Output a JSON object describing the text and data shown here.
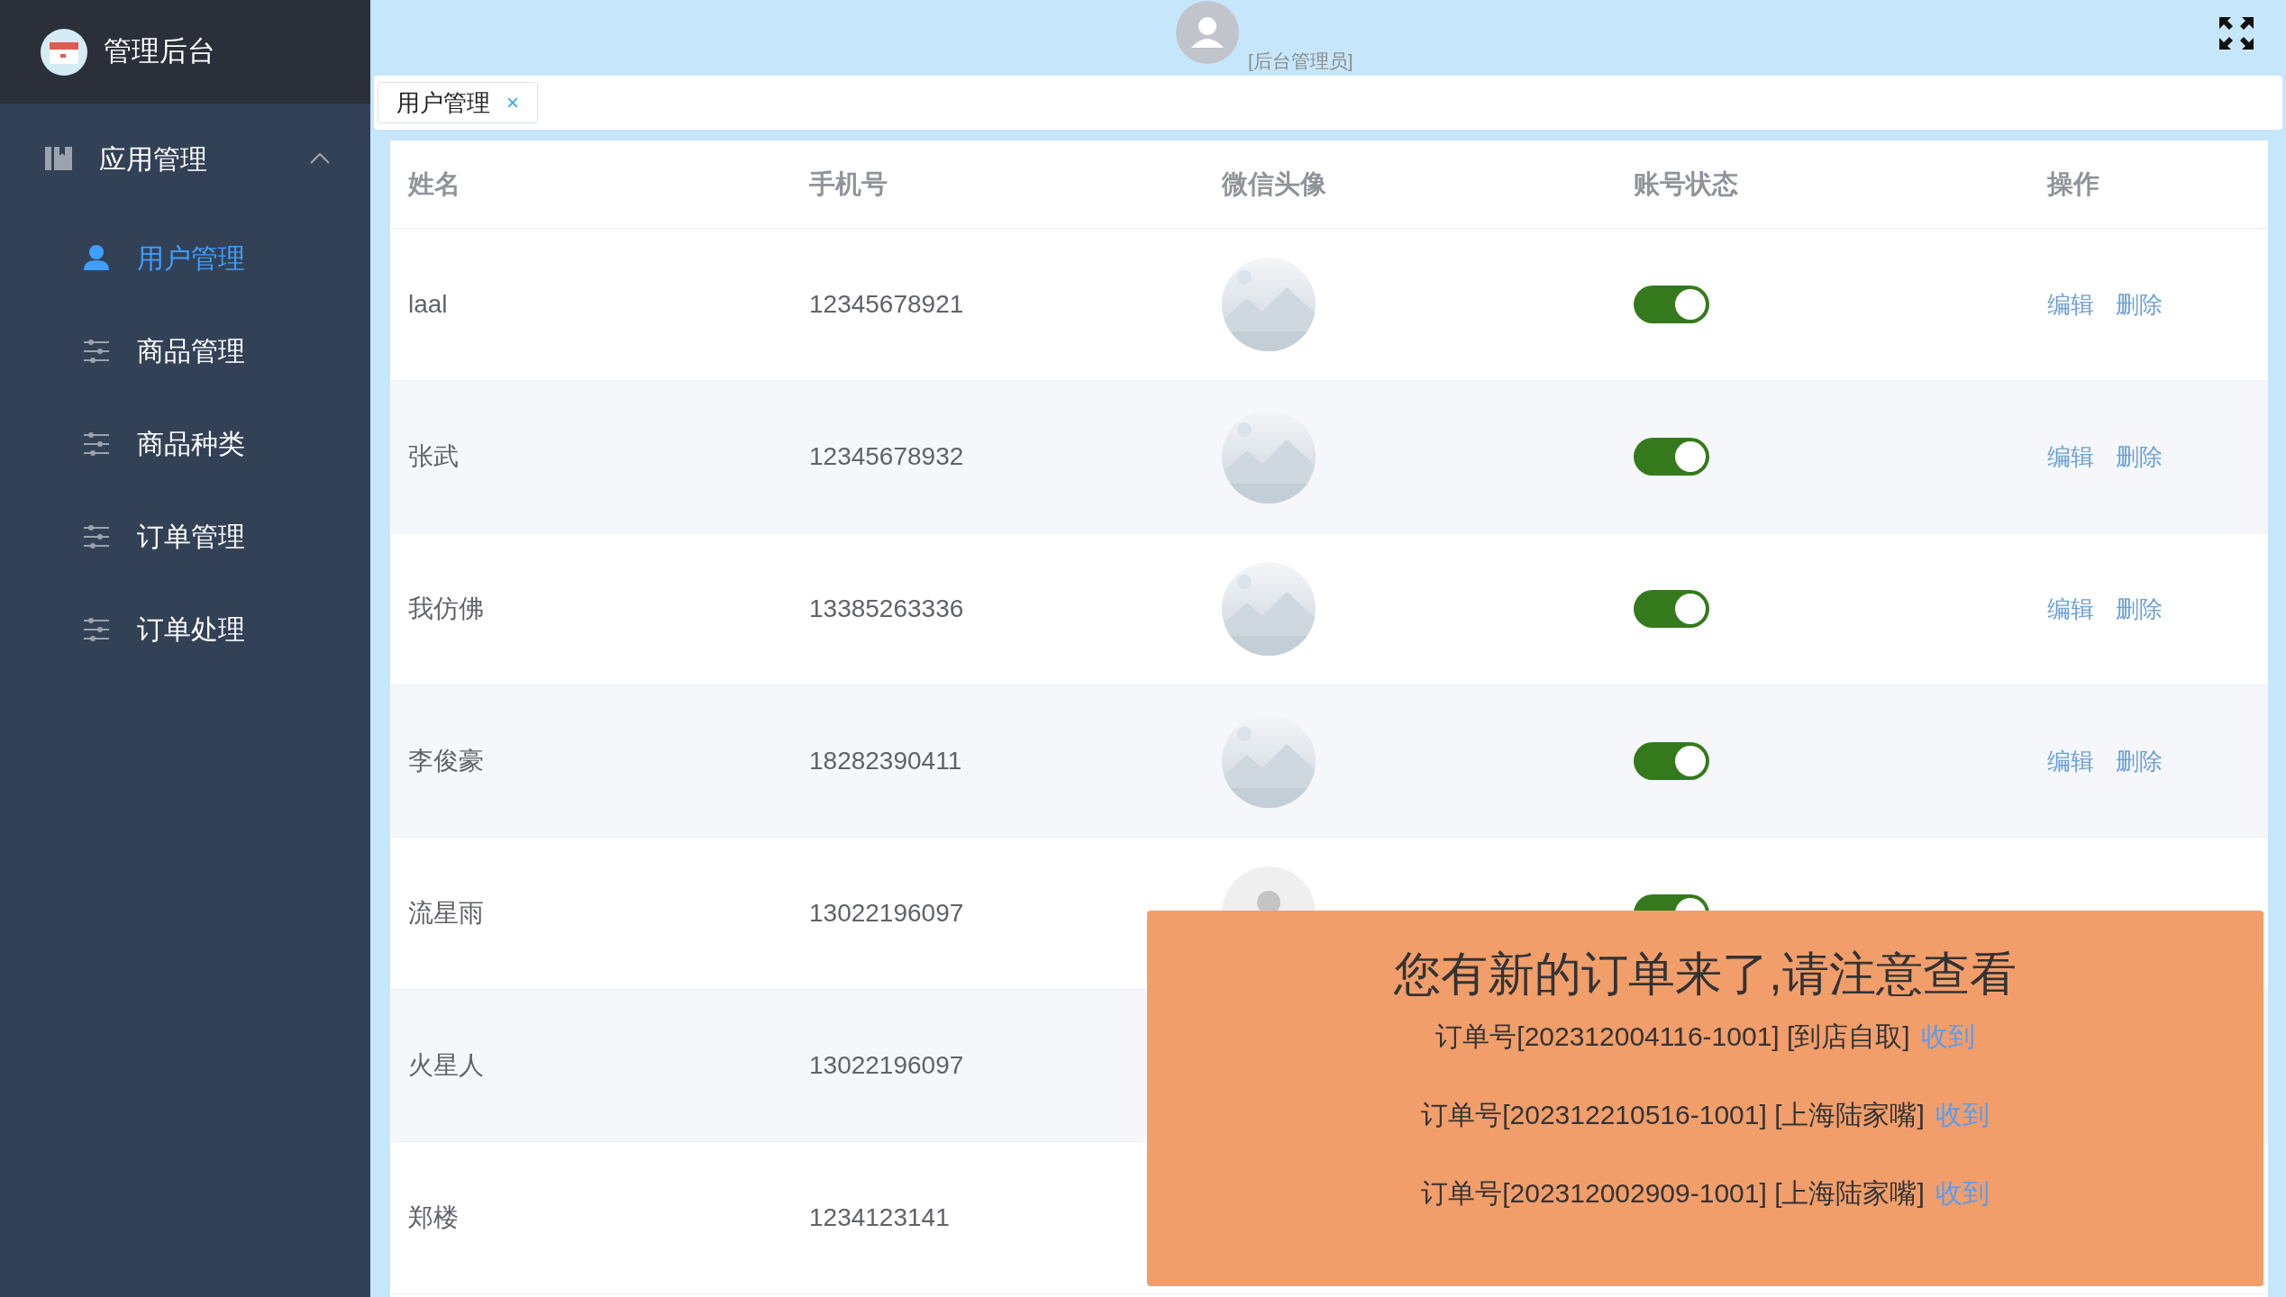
{
  "sidebar": {
    "title": "管理后台",
    "group": {
      "label": "应用管理",
      "expanded": true,
      "items": [
        {
          "label": "用户管理",
          "kind": "user",
          "selected": true
        },
        {
          "label": "商品管理",
          "kind": "sliders",
          "selected": false
        },
        {
          "label": "商品种类",
          "kind": "sliders",
          "selected": false
        },
        {
          "label": "订单管理",
          "kind": "sliders",
          "selected": false
        },
        {
          "label": "订单处理",
          "kind": "sliders",
          "selected": false
        }
      ]
    }
  },
  "header": {
    "role": "[后台管理员]"
  },
  "tabs": [
    {
      "label": "用户管理",
      "close": "×",
      "selected": true
    }
  ],
  "table": {
    "columns": [
      "姓名",
      "手机号",
      "微信头像",
      "账号状态",
      "操作"
    ],
    "rows": [
      {
        "name": "laal",
        "phone": "12345678921",
        "avatar": {
          "kind": "picture"
        },
        "on": true,
        "actions": [
          "编辑",
          "删除"
        ]
      },
      {
        "name": "张武",
        "phone": "12345678932",
        "avatar": {
          "kind": "picture"
        },
        "on": true,
        "actions": [
          "编辑",
          "删除"
        ]
      },
      {
        "name": "我仿佛",
        "phone": "13385263336",
        "avatar": {
          "kind": "picture"
        },
        "on": true,
        "actions": [
          "编辑",
          "删除"
        ]
      },
      {
        "name": "李俊豪",
        "phone": "18282390411",
        "avatar": {
          "kind": "picture"
        },
        "on": true,
        "actions": [
          "编辑",
          "删除"
        ]
      },
      {
        "name": "流星雨",
        "phone": "13022196097",
        "avatar": {
          "kind": "person"
        },
        "on": true
      },
      {
        "name": "火星人",
        "phone": "13022196097"
      },
      {
        "name": "郑楼",
        "phone": "1234123141"
      }
    ]
  },
  "notification": {
    "title": "您有新的订单来了,请注意查看",
    "orders": [
      {
        "text": "订单号[202312004116-1001] [到店自取]",
        "action": "收到"
      },
      {
        "text": "订单号[202312210516-1001] [上海陆家嘴]",
        "action": "收到"
      },
      {
        "text": "订单号[202312002909-1001] [上海陆家嘴]",
        "action": "收到"
      }
    ]
  }
}
